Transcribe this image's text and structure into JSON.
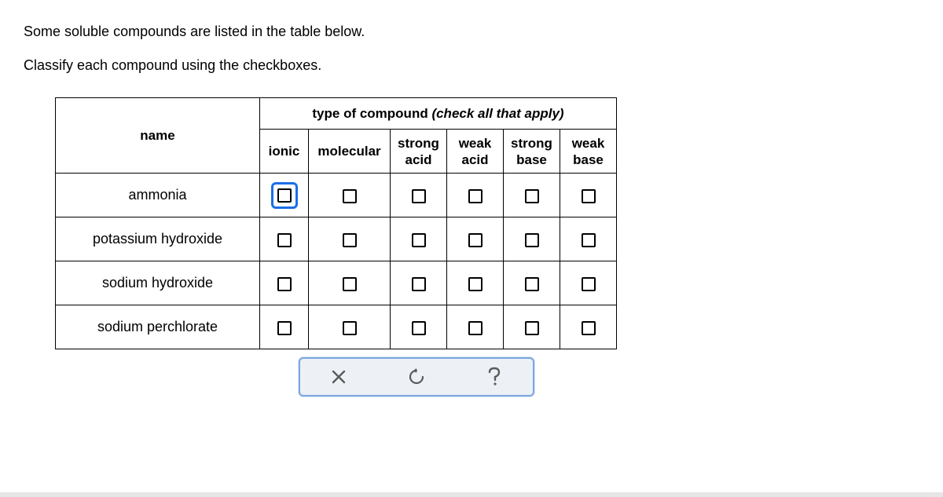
{
  "intro": {
    "line1": "Some soluble compounds are listed in the table below.",
    "line2": "Classify each compound using the checkboxes."
  },
  "table": {
    "name_header": "name",
    "group_header_plain": "type of compound ",
    "group_header_italic": "(check all that apply)",
    "columns": {
      "ionic": "ionic",
      "molecular": "molecular",
      "strong_acid_l1": "strong",
      "strong_acid_l2": "acid",
      "weak_acid_l1": "weak",
      "weak_acid_l2": "acid",
      "strong_base_l1": "strong",
      "strong_base_l2": "base",
      "weak_base_l1": "weak",
      "weak_base_l2": "base"
    },
    "rows": [
      {
        "name": "ammonia"
      },
      {
        "name": "potassium hydroxide"
      },
      {
        "name": "sodium hydroxide"
      },
      {
        "name": "sodium perchlorate"
      }
    ],
    "focused": {
      "row": 0,
      "col": "ionic"
    }
  }
}
